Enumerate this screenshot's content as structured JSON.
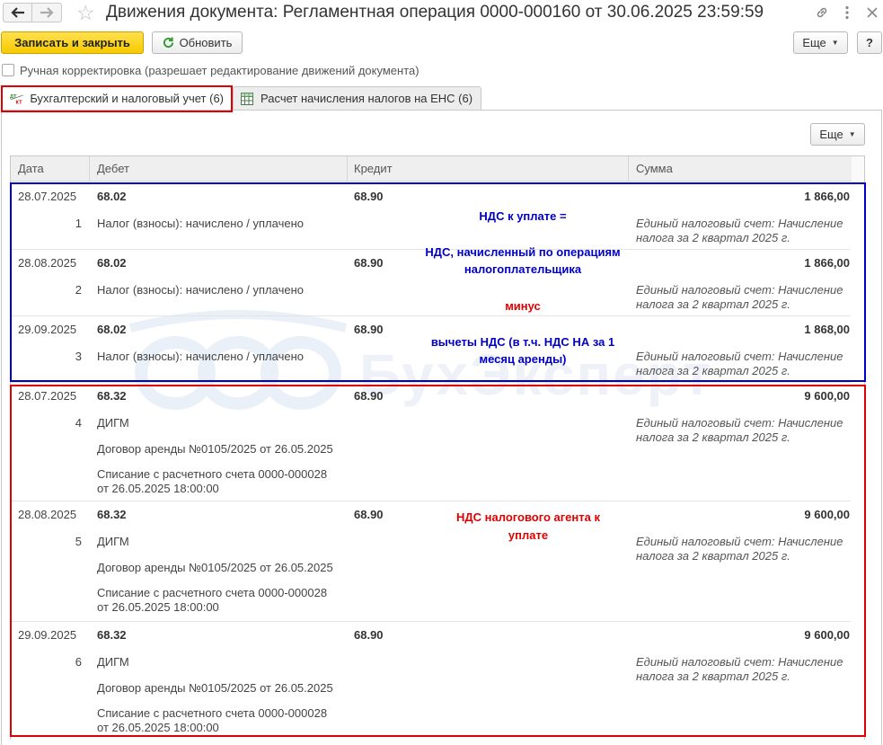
{
  "window": {
    "title": "Движения документа: Регламентная операция 0000-000160 от 30.06.2025 23:59:59"
  },
  "toolbar": {
    "save_close": "Записать и закрыть",
    "refresh": "Обновить",
    "more": "Еще",
    "help": "?"
  },
  "manual": {
    "label": "Ручная корректировка (разрешает редактирование движений документа)"
  },
  "tabs": [
    {
      "label": "Бухгалтерский и налоговый учет (6)",
      "icon": "dt-kt-icon"
    },
    {
      "label": "Расчет начисления налогов на ЕНС (6)",
      "icon": "table-icon"
    }
  ],
  "panel": {
    "more": "Еще"
  },
  "table": {
    "headers": [
      "Дата",
      "Дебет",
      "Кредит",
      "Сумма"
    ],
    "rows": [
      {
        "date": "28.07.2025",
        "num": "1",
        "debit": "68.02",
        "debit_lines": [
          "Налог (взносы): начислено / уплачено"
        ],
        "credit": "68.90",
        "sum": "1 866,00",
        "content": "Единый налоговый счет: Начисление налога за 2 квартал 2025 г."
      },
      {
        "date": "28.08.2025",
        "num": "2",
        "debit": "68.02",
        "debit_lines": [
          "Налог (взносы): начислено / уплачено"
        ],
        "credit": "68.90",
        "sum": "1 866,00",
        "content": "Единый налоговый счет: Начисление налога за 2 квартал 2025 г."
      },
      {
        "date": "29.09.2025",
        "num": "3",
        "debit": "68.02",
        "debit_lines": [
          "Налог (взносы): начислено / уплачено"
        ],
        "credit": "68.90",
        "sum": "1 868,00",
        "content": "Единый налоговый счет: Начисление налога за 2 квартал 2025 г."
      },
      {
        "date": "28.07.2025",
        "num": "4",
        "debit": "68.32",
        "debit_lines": [
          "ДИГМ",
          "Договор аренды №0105/2025 от 26.05.2025",
          "Списание с расчетного счета 0000-000028",
          "от 26.05.2025 18:00:00"
        ],
        "credit": "68.90",
        "sum": "9 600,00",
        "content": "Единый налоговый счет: Начисление налога за 2 квартал 2025 г."
      },
      {
        "date": "28.08.2025",
        "num": "5",
        "debit": "68.32",
        "debit_lines": [
          "ДИГМ",
          "Договор аренды №0105/2025 от 26.05.2025",
          "Списание с расчетного счета 0000-000028",
          "от 26.05.2025 18:00:00"
        ],
        "credit": "68.90",
        "sum": "9 600,00",
        "content": "Единый налоговый счет: Начисление налога за 2 квартал 2025 г."
      },
      {
        "date": "29.09.2025",
        "num": "6",
        "debit": "68.32",
        "debit_lines": [
          "ДИГМ",
          "Договор аренды №0105/2025 от 26.05.2025",
          "Списание с расчетного счета 0000-000028",
          "от 26.05.2025 18:00:00"
        ],
        "credit": "68.90",
        "sum": "9 600,00",
        "content": "Единый налоговый счет: Начисление налога за 2 квартал 2025 г."
      }
    ]
  },
  "annotations": {
    "blue": [
      "НДС к уплате =",
      "НДС, начисленный по операциям",
      "налогоплательщика",
      "минус",
      "вычеты НДС (в т.ч. НДС НА за 1",
      "месяц аренды)"
    ],
    "red": [
      "НДС налогового агента к",
      "уплате"
    ],
    "blue_color": "#0000c8",
    "red_color": "#e00000"
  },
  "watermark": {
    "text": "БухЭксперт"
  }
}
